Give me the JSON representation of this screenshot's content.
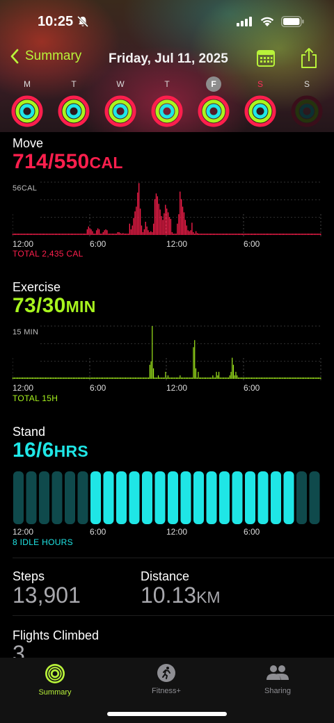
{
  "status_bar": {
    "time": "10:25"
  },
  "nav": {
    "back_label": "Summary",
    "date": "Friday, Jul 11, 2025"
  },
  "week": [
    {
      "letter": "M",
      "state": "complete"
    },
    {
      "letter": "T",
      "state": "complete"
    },
    {
      "letter": "W",
      "state": "complete"
    },
    {
      "letter": "T",
      "state": "complete"
    },
    {
      "letter": "F",
      "state": "selected"
    },
    {
      "letter": "S",
      "state": "complete"
    },
    {
      "letter": "S",
      "state": "empty"
    }
  ],
  "move": {
    "title": "Move",
    "value": "714/550",
    "unit": "CAL",
    "scale_label": "56CAL",
    "total": "TOTAL 2,435 CAL",
    "color": "#ff1f4d"
  },
  "exercise": {
    "title": "Exercise",
    "value": "73/30",
    "unit": "MIN",
    "scale_label": "15 MIN",
    "total": "TOTAL 15H",
    "color": "#a8f51e"
  },
  "stand": {
    "title": "Stand",
    "value": "16/6",
    "unit": "HRS",
    "idle": "8 IDLE HOURS",
    "color": "#1fe6e6"
  },
  "axis_labels": [
    "12:00",
    "6:00",
    "12:00",
    "6:00"
  ],
  "steps": {
    "label": "Steps",
    "value": "13,901"
  },
  "distance": {
    "label": "Distance",
    "value": "10.13",
    "unit": "KM"
  },
  "flights": {
    "label": "Flights Climbed",
    "value": "3"
  },
  "tabs": [
    {
      "label": "Summary",
      "active": true
    },
    {
      "label": "Fitness+",
      "active": false
    },
    {
      "label": "Sharing",
      "active": false
    }
  ],
  "chart_data": [
    {
      "type": "bar",
      "title": "Move",
      "ylabel": "56CAL",
      "x_ticks": [
        "12:00",
        "6:00",
        "12:00",
        "6:00"
      ],
      "values": [
        1,
        1,
        1,
        1,
        1,
        1,
        1,
        1,
        1,
        1,
        1,
        1,
        1,
        1,
        1,
        1,
        1,
        1,
        1,
        1,
        1,
        1,
        1,
        1,
        1,
        1,
        1,
        1,
        1,
        1,
        1,
        1,
        1,
        1,
        1,
        1,
        1,
        1,
        1,
        1,
        1,
        1,
        1,
        1,
        1,
        1,
        1,
        1,
        1,
        1,
        1,
        1,
        1,
        1,
        1,
        1,
        6,
        9,
        7,
        6,
        4,
        1,
        1,
        5,
        7,
        6,
        1,
        1,
        3,
        5,
        6,
        5,
        1,
        1,
        1,
        1,
        1,
        1,
        1,
        3,
        3,
        2,
        1,
        2,
        1,
        1,
        1,
        1,
        12,
        6,
        10,
        18,
        25,
        30,
        45,
        55,
        28,
        10,
        3,
        6,
        14,
        9,
        5,
        3,
        4,
        3,
        12,
        38,
        44,
        41,
        33,
        27,
        20,
        16,
        23,
        32,
        28,
        24,
        19,
        17,
        3,
        1,
        1,
        1,
        12,
        22,
        46,
        38,
        30,
        24,
        16,
        10,
        5,
        4,
        5,
        13,
        3,
        1,
        4,
        2,
        1,
        1,
        1,
        1,
        1,
        1,
        1,
        1,
        1,
        1,
        1,
        1,
        1,
        1,
        1,
        1,
        1,
        1,
        1,
        1,
        1,
        1,
        1,
        1,
        1,
        1,
        1,
        1,
        1,
        1,
        1,
        1,
        1,
        1,
        1,
        1,
        1,
        1,
        1,
        1,
        1,
        1,
        1,
        1,
        1,
        1,
        1,
        1,
        1,
        1,
        1,
        1,
        1,
        1,
        1,
        1,
        1,
        1,
        1,
        1,
        1,
        1,
        1,
        1,
        1,
        1,
        1,
        1,
        1,
        1,
        1,
        1,
        1,
        1,
        1,
        1,
        1,
        1,
        1,
        1,
        1,
        1,
        1,
        1,
        1,
        1,
        1,
        1,
        1,
        1,
        1,
        1,
        1
      ],
      "ylim": [
        0,
        56
      ]
    },
    {
      "type": "bar",
      "title": "Exercise",
      "ylabel": "15 MIN",
      "x_ticks": [
        "12:00",
        "6:00",
        "12:00",
        "6:00"
      ],
      "values": [
        0,
        0,
        0,
        0,
        0,
        0,
        0,
        0,
        0,
        0,
        0,
        0,
        0,
        0,
        0,
        0,
        0,
        0,
        0,
        0,
        0,
        0,
        0,
        0,
        0,
        0,
        0,
        0,
        0,
        0,
        0,
        0,
        0,
        0,
        0,
        0,
        0,
        0,
        0,
        0,
        0,
        0,
        0,
        0,
        0,
        0,
        0,
        0,
        0,
        0,
        0,
        0,
        0,
        0,
        0,
        0,
        0,
        0,
        0,
        0,
        0,
        0,
        0,
        0,
        0,
        0,
        0,
        0,
        0,
        0,
        0,
        0,
        0,
        0,
        0,
        0,
        0,
        0,
        0,
        0,
        0,
        0,
        0,
        0,
        0,
        0,
        0,
        0,
        0,
        0,
        0,
        0,
        0,
        0,
        0,
        0,
        0,
        0,
        0,
        0,
        0,
        0,
        0,
        0,
        0,
        0,
        0,
        0,
        0,
        0,
        0,
        0,
        0,
        4,
        5,
        15,
        3,
        0,
        0,
        0,
        1,
        0,
        0,
        0,
        0,
        0,
        2,
        0,
        1,
        0,
        0,
        0,
        0,
        0,
        0,
        0,
        0,
        0,
        1,
        0,
        0,
        0,
        0,
        0,
        0,
        0,
        0,
        0,
        0,
        9,
        11,
        3,
        0,
        2,
        0,
        0,
        0,
        0,
        0,
        0,
        0,
        0,
        0,
        0,
        0,
        1,
        0,
        0,
        2,
        1,
        2,
        0,
        0,
        0,
        0,
        0,
        0,
        0,
        0,
        1,
        2,
        6,
        4,
        1,
        2,
        1,
        0,
        0,
        0,
        0,
        0,
        0,
        0,
        0,
        0,
        0,
        0,
        0,
        0,
        0,
        0,
        0,
        0,
        0,
        0,
        0,
        0,
        0,
        0,
        0,
        0,
        0,
        0,
        0,
        0,
        0,
        0,
        0,
        0,
        0,
        0,
        0,
        0,
        0,
        0,
        0,
        0,
        0,
        0,
        0,
        0,
        0,
        0,
        0,
        0,
        0,
        0,
        0,
        0,
        0,
        0,
        0,
        0,
        0,
        0,
        0,
        0,
        0,
        0,
        0,
        0,
        0,
        0,
        0,
        0
      ],
      "ylim": [
        0,
        15
      ]
    },
    {
      "type": "bar",
      "title": "Stand",
      "x_ticks": [
        "12:00",
        "6:00",
        "12:00",
        "6:00"
      ],
      "values": [
        0,
        0,
        0,
        0,
        0,
        0,
        1,
        1,
        1,
        1,
        1,
        1,
        1,
        1,
        1,
        1,
        1,
        1,
        1,
        1,
        1,
        1,
        0,
        0
      ],
      "categories": [
        "0",
        "1",
        "2",
        "3",
        "4",
        "5",
        "6",
        "7",
        "8",
        "9",
        "10",
        "11",
        "12",
        "13",
        "14",
        "15",
        "16",
        "17",
        "18",
        "19",
        "20",
        "21",
        "22",
        "23"
      ]
    }
  ]
}
